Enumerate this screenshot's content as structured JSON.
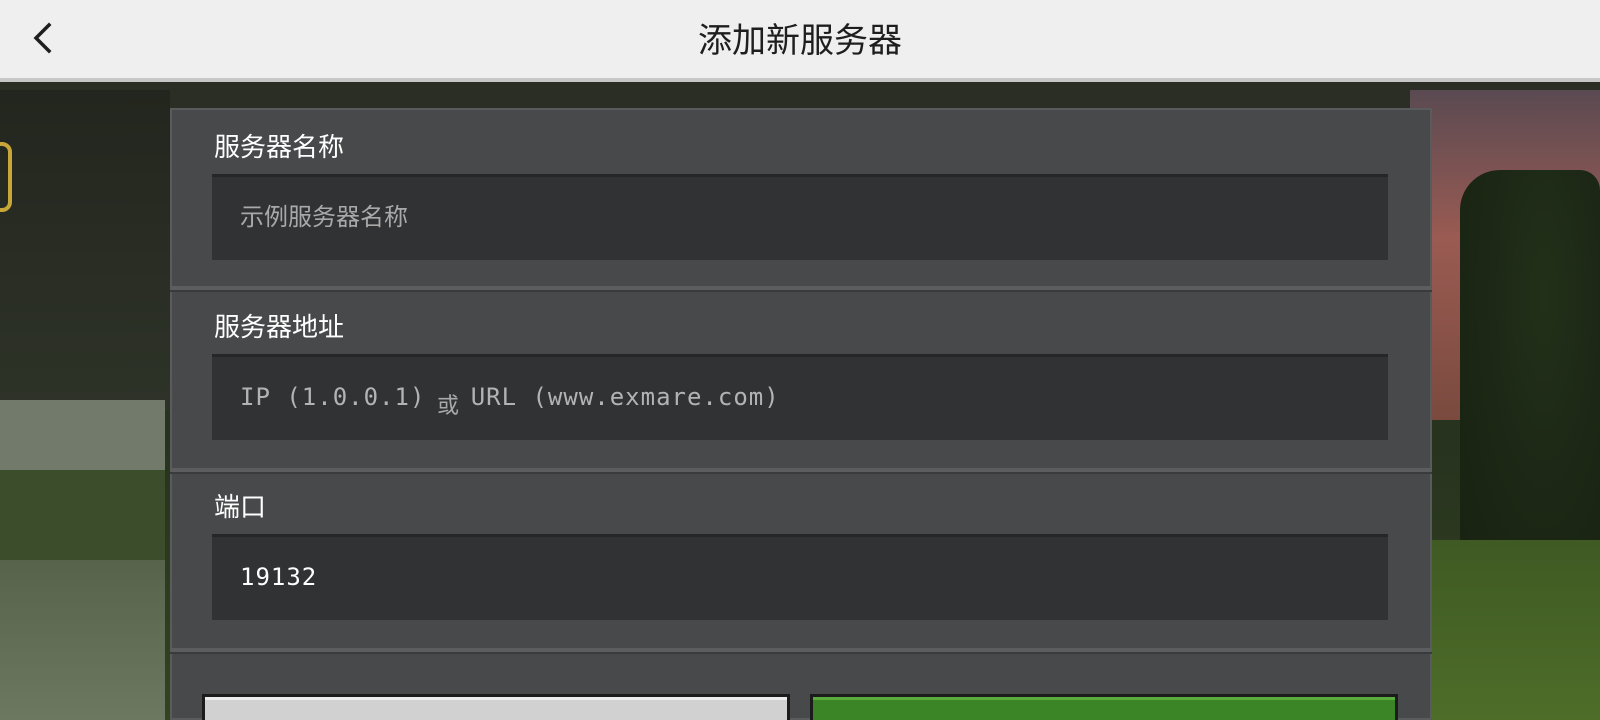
{
  "header": {
    "title": "添加新服务器",
    "back_icon": "chevron-left-icon"
  },
  "form": {
    "server_name": {
      "label": "服务器名称",
      "placeholder": "示例服务器名称",
      "value": ""
    },
    "server_address": {
      "label": "服务器地址",
      "placeholder_ip": "IP (1.0.0.1)",
      "placeholder_or": "或",
      "placeholder_url": "URL (www.exmare.com)",
      "value": ""
    },
    "port": {
      "label": "端口",
      "value": "19132"
    }
  },
  "colors": {
    "header_bg": "#efefef",
    "panel_bg": "#48494a",
    "field_bg": "#313233",
    "secondary_button": "#d1d1d1",
    "primary_button": "#3c8527"
  }
}
